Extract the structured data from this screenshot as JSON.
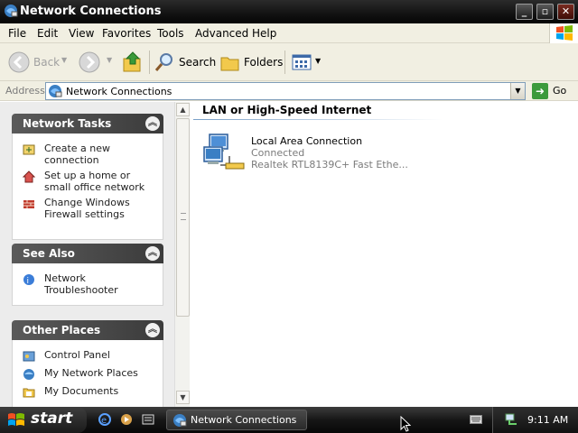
{
  "window": {
    "title": "Network Connections"
  },
  "menu": [
    "File",
    "Edit",
    "View",
    "Favorites",
    "Tools",
    "Advanced",
    "Help"
  ],
  "toolbar": {
    "back": "Back",
    "search": "Search",
    "folders": "Folders"
  },
  "address": {
    "label": "Address",
    "value": "Network Connections",
    "go": "Go"
  },
  "taskpane": {
    "network_tasks": {
      "title": "Network Tasks",
      "items": [
        "Create a new connection",
        "Set up a home or small office network",
        "Change Windows Firewall settings"
      ]
    },
    "see_also": {
      "title": "See Also",
      "items": [
        "Network Troubleshooter"
      ]
    },
    "other_places": {
      "title": "Other Places",
      "items": [
        "Control Panel",
        "My Network Places",
        "My Documents"
      ]
    }
  },
  "content": {
    "group": "LAN or High-Speed Internet",
    "connection": {
      "name": "Local Area Connection",
      "status": "Connected",
      "device": "Realtek RTL8139C+ Fast Ethe..."
    }
  },
  "taskbar": {
    "start": "start",
    "task": "Network Connections",
    "clock": "9:11 AM"
  },
  "icons": {
    "app": "network-connections-icon",
    "back": "back-arrow-icon",
    "forward": "forward-arrow-icon",
    "up": "up-folder-icon",
    "search": "search-magnifier-icon",
    "folders": "folders-icon",
    "views": "views-icon"
  }
}
